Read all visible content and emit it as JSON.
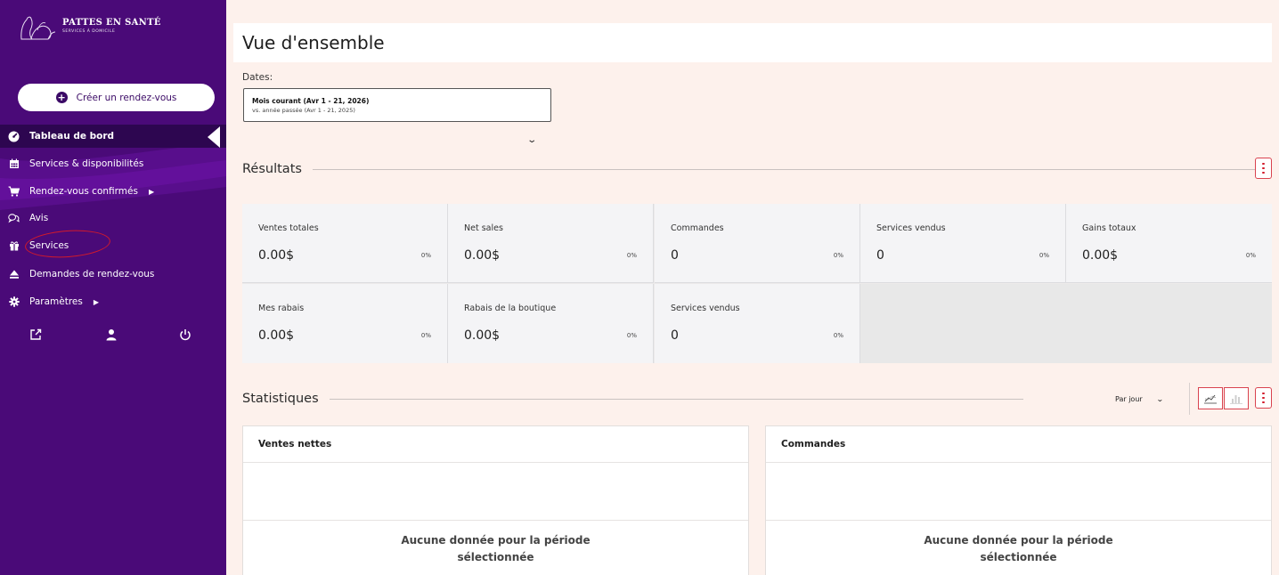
{
  "brand": {
    "name": "PATTES EN SANTÉ",
    "tagline": "SERVICES À DOMICILE"
  },
  "sidebar": {
    "create_button": "Créer un rendez-vous",
    "items": [
      {
        "label": "Tableau de bord",
        "icon": "dashboard-icon"
      },
      {
        "label": "Services & disponibilités",
        "icon": "calendar-icon"
      },
      {
        "label": "Rendez-vous confirmés",
        "icon": "cart-icon"
      },
      {
        "label": "Avis",
        "icon": "reviews-icon"
      },
      {
        "label": "Services",
        "icon": "gift-icon"
      },
      {
        "label": "Demandes de rendez-vous",
        "icon": "eject-icon"
      },
      {
        "label": "Paramètres",
        "icon": "gear-icon"
      }
    ],
    "bottom_icons": [
      "external-link-icon",
      "user-icon",
      "power-icon"
    ]
  },
  "page": {
    "title": "Vue d'ensemble"
  },
  "dates": {
    "label": "Dates:",
    "range": "Mois courant (Avr 1 - 21, 2026)",
    "compare": "vs. année passée (Avr 1 - 21, 2025)"
  },
  "results": {
    "title": "Résultats",
    "stats": [
      {
        "label": "Ventes totales",
        "value": "0.00$",
        "delta": "0%"
      },
      {
        "label": "Net sales",
        "value": "0.00$",
        "delta": "0%"
      },
      {
        "label": "Commandes",
        "value": "0",
        "delta": "0%"
      },
      {
        "label": "Services vendus",
        "value": "0",
        "delta": "0%"
      },
      {
        "label": "Gains totaux",
        "value": "0.00$",
        "delta": "0%"
      },
      {
        "label": "Mes rabais",
        "value": "0.00$",
        "delta": "0%"
      },
      {
        "label": "Rabais de la boutique",
        "value": "0.00$",
        "delta": "0%"
      },
      {
        "label": "Services vendus",
        "value": "0",
        "delta": "0%"
      }
    ]
  },
  "statistics": {
    "title": "Statistiques",
    "interval": "Par jour",
    "panels": [
      {
        "title": "Ventes nettes",
        "empty_line1": "Aucune donnée pour la période",
        "empty_line2": "sélectionnée"
      },
      {
        "title": "Commandes",
        "empty_line1": "Aucune donnée pour la période",
        "empty_line2": "sélectionnée"
      }
    ]
  },
  "colors": {
    "sidebar": "#4a0a78",
    "active": "#2d0650",
    "accent": "#d9434f",
    "background": "#fdf1ec"
  }
}
